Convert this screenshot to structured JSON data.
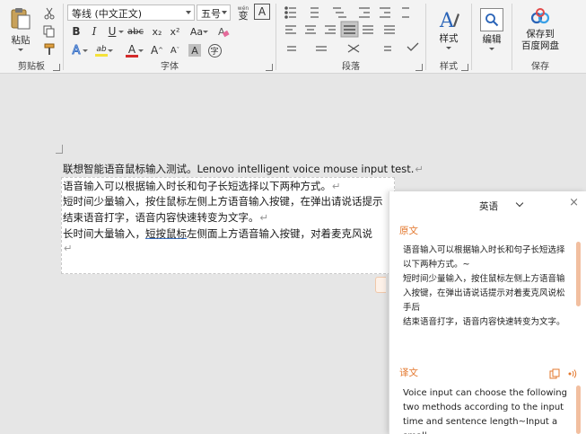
{
  "ribbon": {
    "clipboard": {
      "paste_label": "粘贴",
      "group_label": "剪贴板"
    },
    "font": {
      "font_name": "等线 (中文正文)",
      "font_size": "五号",
      "wen": "wén",
      "wen_char": "变",
      "box_a": "A",
      "bold": "B",
      "italic": "I",
      "underline": "U",
      "strike": "abc",
      "sub": "x₂",
      "sup": "x²",
      "case": "Aa",
      "text_effect": "A",
      "highlight": "ab",
      "font_color": "A",
      "grow": "A",
      "shrink": "A",
      "group_label": "字体"
    },
    "paragraph": {
      "group_label": "段落"
    },
    "styles": {
      "label": "样式",
      "group_label": "样式"
    },
    "edit": {
      "label": "编辑"
    },
    "save": {
      "label_line1": "保存到",
      "label_line2": "百度网盘",
      "group_label": "保存"
    },
    "colors": {
      "accent_red": "#d42a2a",
      "highlight_yellow": "#f5e23a",
      "styles_blue": "#2a64b8"
    }
  },
  "document": {
    "line1": "联想智能语音鼠标输入测试。Lenovo intelligent voice mouse input test.",
    "line2": "语音输入可以根据输入时长和句子长短选择以下两种方式。",
    "line3": "短时间少量输入，按住鼠标左侧上方语音输入按键，在弹出请说话提示",
    "line4": "结束语音打字，语音内容快速转变为文字。",
    "line5_pre": "长时间大量输入，",
    "line5_ul": "短按鼠标",
    "line5_post": "左侧面上方语音输入按键，对着麦克风说",
    "pilcrow": "↵"
  },
  "panel": {
    "language": "英语",
    "close": "×",
    "source_title": "原文",
    "source_lines": [
      "语音输入可以根据输入时长和句子长短选择",
      "以下两种方式。~",
      "短时间少量输入，按住鼠标左侧上方语音输",
      "入按键，在弹出请说话提示对着麦克风说松",
      "手后",
      "结束语音打字，语音内容快速转变为文字。"
    ],
    "target_title": "译文",
    "target_lines": [
      "Voice input can choose the following",
      "two methods according to the input",
      "time and sentence length~Input a small"
    ]
  }
}
